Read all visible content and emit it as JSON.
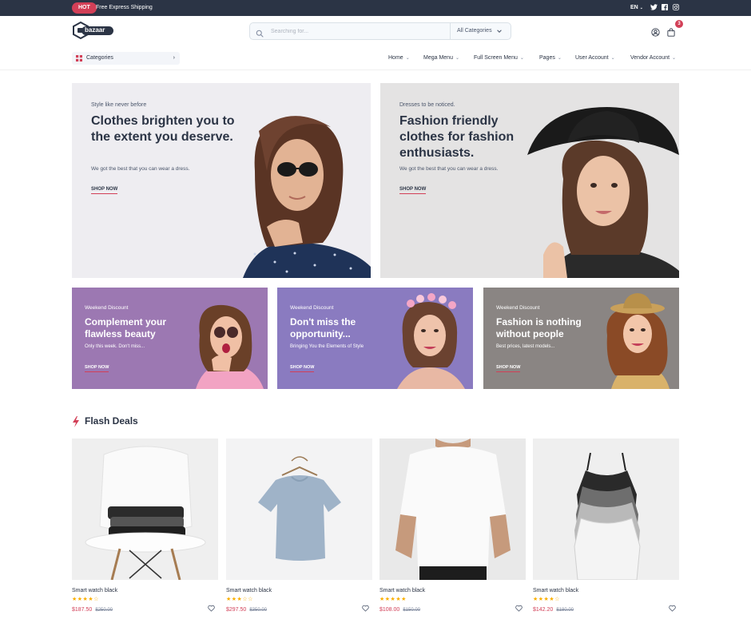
{
  "topbar": {
    "badge": "HOT",
    "text": "Free Express Shipping",
    "language": "EN",
    "socials": [
      "twitter-icon",
      "facebook-icon",
      "instagram-icon"
    ]
  },
  "header": {
    "logo_text": "bazaar",
    "search": {
      "placeholder": "Searching for...",
      "category": "All Categories"
    },
    "cart_count": "3"
  },
  "nav": {
    "categories_label": "Categories",
    "items": [
      "Home",
      "Mega Menu",
      "Full Screen Menu",
      "Pages",
      "User Account",
      "Vendor Account"
    ]
  },
  "hero": [
    {
      "eyebrow": "Style like never before",
      "title": "Clothes brighten you to the extent you deserve.",
      "description": "We got the best that you can wear a dress.",
      "cta": "SHOP NOW"
    },
    {
      "eyebrow": "Dresses to be noticed.",
      "title": "Fashion friendly clothes for fashion enthusiasts.",
      "description": "We got the best that you can wear a dress.",
      "cta": "SHOP NOW"
    }
  ],
  "promos": [
    {
      "eyebrow": "Weekend Discount",
      "title": "Complement your flawless beauty",
      "description": "Only this week. Don't miss...",
      "cta": "SHOP NOW"
    },
    {
      "eyebrow": "Weekend Discount",
      "title": "Don't miss the opportunity...",
      "description": "Bringing You the Elements of Style",
      "cta": "SHOP NOW"
    },
    {
      "eyebrow": "Weekend Discount",
      "title": "Fashion is nothing without people",
      "description": "Best prices, latest models...",
      "cta": "SHOP NOW"
    }
  ],
  "flash_deals": {
    "title": "Flash Deals",
    "products": [
      {
        "name": "Smart watch black",
        "rating": 4,
        "stars": "★★★★☆",
        "price": "$187.50",
        "old_price": "$250.00"
      },
      {
        "name": "Smart watch black",
        "rating": 3,
        "stars": "★★★☆☆",
        "price": "$297.50",
        "old_price": "$350.00"
      },
      {
        "name": "Smart watch black",
        "rating": 5,
        "stars": "★★★★★",
        "price": "$108.00",
        "old_price": "$150.00"
      },
      {
        "name": "Smart watch black",
        "rating": 4,
        "stars": "★★★★☆",
        "price": "$142.20",
        "old_price": "$180.00"
      }
    ]
  },
  "colors": {
    "primary": "#d23f57",
    "dark": "#2b3445",
    "star": "#faaf00"
  }
}
